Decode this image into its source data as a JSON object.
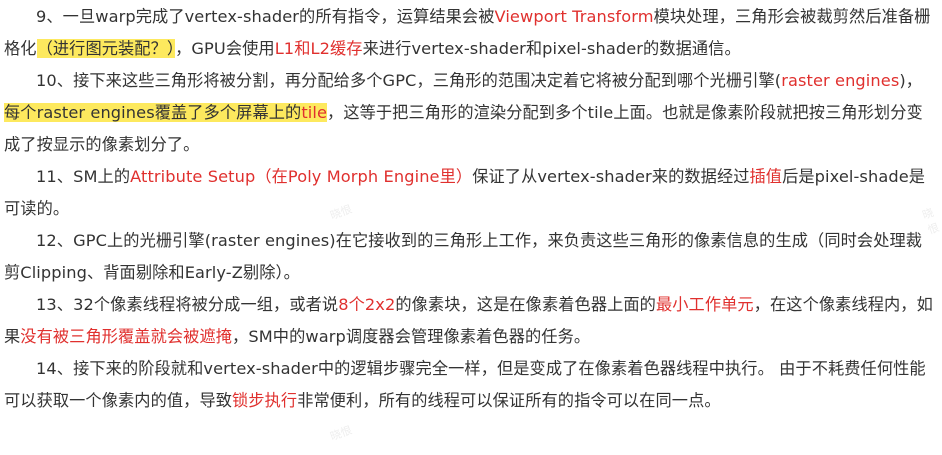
{
  "paragraphs": [
    {
      "segments": [
        {
          "text": "9、一旦warp完成了vertex-shader的所有指令，运算结果会被"
        },
        {
          "text": "Viewport Transform",
          "style": "red"
        },
        {
          "text": "模块处理，三角形会被裁剪然后准备栅格化"
        },
        {
          "text": "（进行图元装配？）",
          "style": "highlight"
        },
        {
          "text": "，GPU会使用"
        },
        {
          "text": "L1和L2缓存",
          "style": "red"
        },
        {
          "text": "来进行vertex-shader和pixel-shader的数据通信。"
        }
      ]
    },
    {
      "segments": [
        {
          "text": "10、接下来这些三角形将被分割，再分配给多个GPC，三角形的范围决定着它将被分配到哪个光栅引擎("
        },
        {
          "text": "raster engines",
          "style": "red"
        },
        {
          "text": ")，"
        },
        {
          "text": "每个raster engines覆盖了多个屏幕上的",
          "style": "highlight"
        },
        {
          "text": "tile",
          "style": "highlight-red"
        },
        {
          "text": "，这等于把三角形的渲染分配到多个tile上面。也就是像素阶段就把按三角形划分变成了按显示的像素划分了。"
        }
      ]
    },
    {
      "segments": [
        {
          "text": "11、SM上的"
        },
        {
          "text": "Attribute Setup（在Poly Morph Engine里）",
          "style": "red"
        },
        {
          "text": "保证了从vertex-shader来的数据经过"
        },
        {
          "text": "插值",
          "style": "red"
        },
        {
          "text": "后是pixel-shade是可读的。"
        }
      ]
    },
    {
      "segments": [
        {
          "text": "12、GPC上的光栅引擎(raster engines)在它接收到的三角形上工作，来负责这些三角形的像素信息的生成（同时会处理裁剪Clipping、背面剔除和Early-Z剔除）。"
        }
      ]
    },
    {
      "segments": [
        {
          "text": "13、32个像素线程将被分成一组，或者说"
        },
        {
          "text": "8个2x2",
          "style": "red"
        },
        {
          "text": "的像素块，这是在像素着色器上面的"
        },
        {
          "text": "最小工作单元",
          "style": "red"
        },
        {
          "text": "，在这个像素线程内，如果"
        },
        {
          "text": "没有被三角形覆盖就会被遮掩",
          "style": "red"
        },
        {
          "text": "，SM中的warp调度器会管理像素着色器的任务。"
        }
      ]
    },
    {
      "segments": [
        {
          "text": "14、接下来的阶段就和vertex-shader中的逻辑步骤完全一样，但是变成了在像素着色器线程中执行。 由于不耗费任何性能可以获取一个像素内的值，导致"
        },
        {
          "text": "锁步执行",
          "style": "red"
        },
        {
          "text": "非常便利，所有的线程可以保证所有的指令可以在同一点。"
        }
      ]
    }
  ],
  "watermark": "晓恨",
  "colors": {
    "text": "#333333",
    "accent_red": "#e0302e",
    "highlight": "#fde95e"
  }
}
